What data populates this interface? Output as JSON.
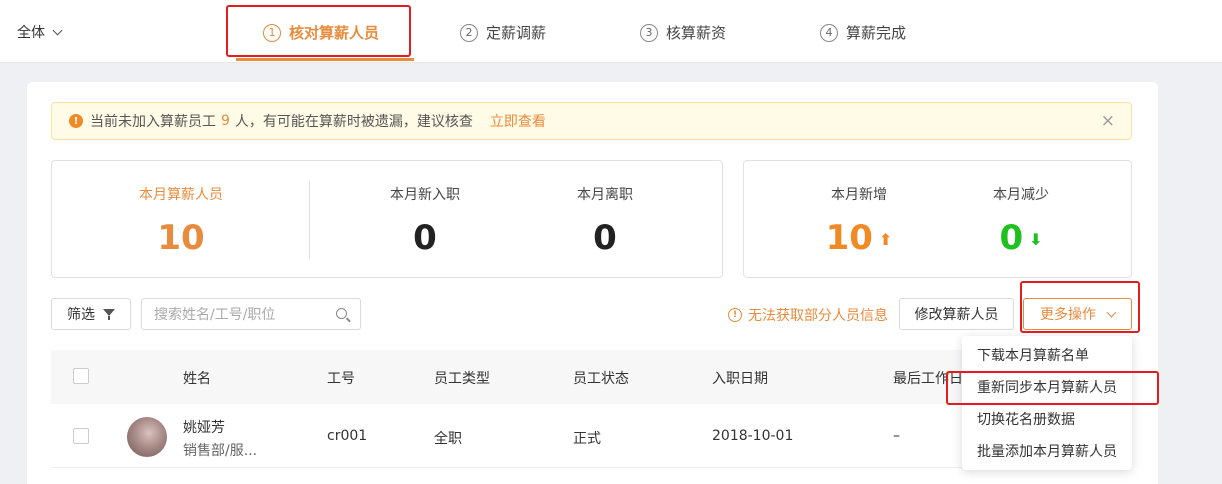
{
  "topbar": {
    "scope_label": "全体",
    "steps": [
      {
        "num": "1",
        "label": "核对算薪人员",
        "active": true
      },
      {
        "num": "2",
        "label": "定薪调薪",
        "active": false
      },
      {
        "num": "3",
        "label": "核算薪资",
        "active": false
      },
      {
        "num": "4",
        "label": "算薪完成",
        "active": false
      }
    ]
  },
  "alert": {
    "text_before": "当前未加入算薪员工",
    "count": "9",
    "text_after": "人，有可能在算薪时被遗漏，建议核查",
    "link": "立即查看",
    "close": "×"
  },
  "stats_left": [
    {
      "label": "本月算薪人员",
      "value": "10"
    },
    {
      "label": "本月新入职",
      "value": "0"
    },
    {
      "label": "本月离职",
      "value": "0"
    }
  ],
  "stats_right": [
    {
      "label": "本月新增",
      "value": "10",
      "arrow": "⬆"
    },
    {
      "label": "本月减少",
      "value": "0",
      "arrow": "⬇"
    }
  ],
  "toolbar": {
    "filter_label": "筛选",
    "search_placeholder": "搜索姓名/工号/职位",
    "warning": "无法获取部分人员信息",
    "edit_label": "修改算薪人员",
    "more_label": "更多操作"
  },
  "table": {
    "headers": [
      "姓名",
      "工号",
      "员工类型",
      "员工状态",
      "入职日期",
      "最后工作日"
    ],
    "rows": [
      {
        "name": "姚娅芳",
        "dept": "销售部/服...",
        "id": "cr001",
        "type": "全职",
        "status": "正式",
        "hire_date": "2018-10-01",
        "last_day": "–"
      }
    ]
  },
  "dropdown": {
    "items": [
      "下载本月算薪名单",
      "重新同步本月算薪人员",
      "切换花名册数据",
      "批量添加本月算薪人员"
    ]
  },
  "colors": {
    "accent": "#e98b3c",
    "increase": "#f08a24",
    "decrease": "#1fc01f",
    "highlight": "#e21d1d"
  }
}
